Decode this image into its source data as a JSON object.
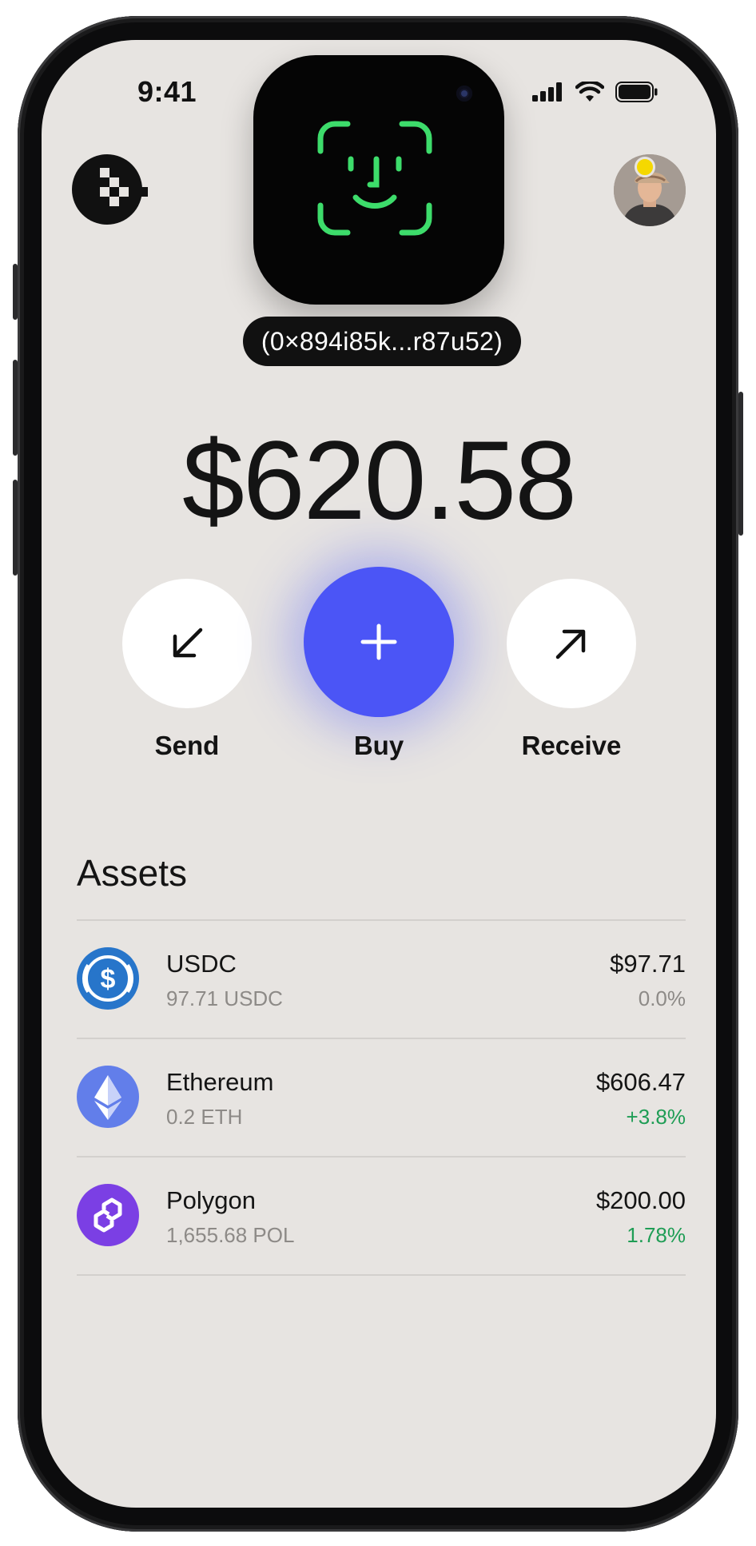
{
  "status_bar": {
    "time": "9:41"
  },
  "wallet": {
    "address": "(0×894i85k...r87u52)",
    "balance": "$620.58"
  },
  "actions": [
    {
      "label": "Send",
      "icon": "arrow-down-left-icon"
    },
    {
      "label": "Buy",
      "icon": "plus-icon"
    },
    {
      "label": "Receive",
      "icon": "arrow-up-right-icon"
    }
  ],
  "assets": {
    "title": "Assets",
    "items": [
      {
        "name": "USDC",
        "amount": "97.71 USDC",
        "value": "$97.71",
        "change": "0.0%",
        "trend": "neutral",
        "icon": "usdc-icon"
      },
      {
        "name": "Ethereum",
        "amount": "0.2 ETH",
        "value": "$606.47",
        "change": "+3.8%",
        "trend": "up",
        "icon": "ethereum-icon"
      },
      {
        "name": "Polygon",
        "amount": "1,655.68 POL",
        "value": "$200.00",
        "change": "1.78%",
        "trend": "up",
        "icon": "polygon-icon"
      }
    ]
  },
  "colors": {
    "accent": "#4b55f6",
    "positive": "#1f9d55",
    "faceid": "#3ddc6b",
    "background": "#e7e4e1"
  }
}
